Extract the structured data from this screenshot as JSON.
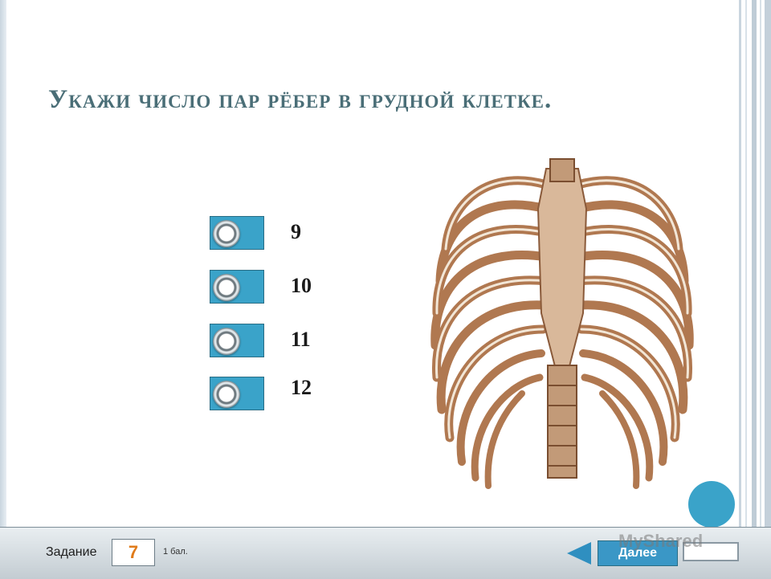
{
  "question": {
    "title": "Укажи число пар рёбер в грудной клетке."
  },
  "options": [
    {
      "label": "9"
    },
    {
      "label": "10"
    },
    {
      "label": "11"
    },
    {
      "label": "12"
    }
  ],
  "footer": {
    "task_label": "Задание",
    "task_number": "7",
    "score": "1 бал.",
    "next_label": "Далее",
    "watermark": "MyShared"
  },
  "colors": {
    "title": "#4a6e77",
    "option_button": "#3aa3c9",
    "task_number": "#e07b1a"
  },
  "icons": [
    "radio-icon",
    "ribcage-illustration",
    "back-arrow-icon"
  ]
}
